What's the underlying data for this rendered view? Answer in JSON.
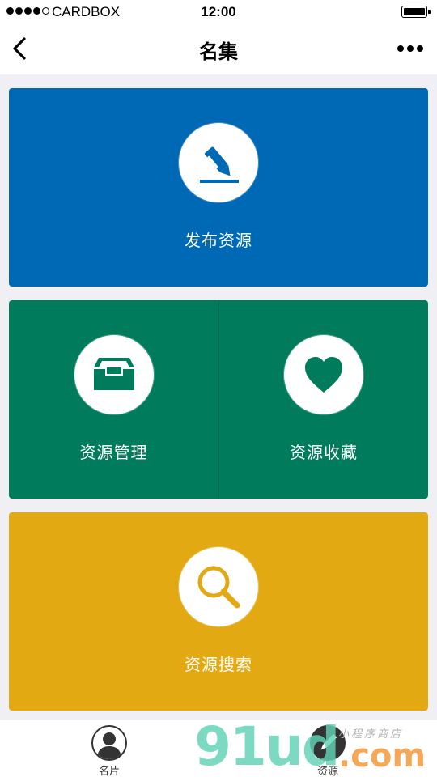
{
  "status_bar": {
    "carrier": "CARDBOX",
    "time": "12:00",
    "signal_bars": 5,
    "signal_filled": 4,
    "battery_level": 1.0
  },
  "nav": {
    "title": "名集",
    "back_icon": "chevron-left-icon",
    "more_icon": "more-dots-icon"
  },
  "tiles": {
    "publish": {
      "label": "发布资源",
      "icon": "pen-icon",
      "color": "#0069b5"
    },
    "manage": {
      "label": "资源管理",
      "icon": "inbox-tray-icon",
      "color": "#007c5d"
    },
    "favorites": {
      "label": "资源收藏",
      "icon": "heart-icon",
      "color": "#007c5d"
    },
    "search": {
      "label": "资源搜索",
      "icon": "search-icon",
      "color": "#e3a913"
    }
  },
  "tab_bar": {
    "tabs": [
      {
        "label": "名片",
        "icon": "user-avatar-icon"
      },
      {
        "label": "资源",
        "icon": "pen-icon"
      }
    ]
  },
  "watermark": {
    "main": "91ud",
    "suffix": ".com",
    "tagline": "小程序商店"
  }
}
